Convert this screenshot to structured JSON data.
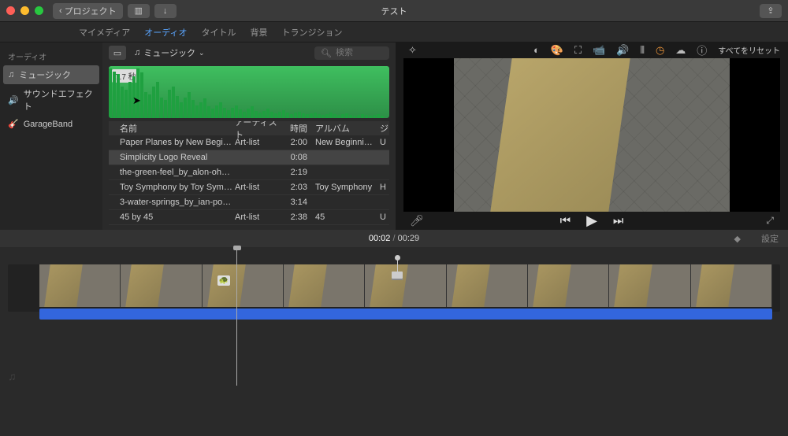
{
  "titlebar": {
    "back": "プロジェクト",
    "title": "テスト"
  },
  "tabs": [
    "マイメディア",
    "オーディオ",
    "タイトル",
    "背景",
    "トランジション"
  ],
  "tabs_active": 1,
  "sidebar": {
    "header": "オーディオ",
    "items": [
      {
        "icon": "♫",
        "label": "ミュージック",
        "sel": true
      },
      {
        "icon": "🔊",
        "label": "サウンドエフェクト"
      },
      {
        "icon": "🎸",
        "label": "GarageBand"
      }
    ]
  },
  "browser": {
    "source": "ミュージック",
    "search_ph": "検索",
    "waveform_dur": "7.7 秒",
    "headers": {
      "name": "名前",
      "artist": "アーティスト",
      "time": "時間",
      "album": "アルバム",
      "genre": "ジ"
    },
    "rows": [
      {
        "name": "Paper Planes by New Beginn...",
        "artist": "Art-list",
        "time": "2:00",
        "album": "New Beginnin...",
        "g": "U"
      },
      {
        "name": "Simplicity Logo Reveal",
        "artist": "",
        "time": "0:08",
        "album": "",
        "g": "",
        "sel": true
      },
      {
        "name": "the-green-feel_by_alon-ohan...",
        "artist": "",
        "time": "2:19",
        "album": "",
        "g": ""
      },
      {
        "name": "Toy Symphony by Toy Symp...",
        "artist": "Art-list",
        "time": "2:03",
        "album": "Toy Symphony",
        "g": "H"
      },
      {
        "name": "3-water-springs_by_ian-post...",
        "artist": "",
        "time": "3:14",
        "album": "",
        "g": ""
      },
      {
        "name": "45 by 45",
        "artist": "Art-list",
        "time": "2:38",
        "album": "45",
        "g": "U"
      }
    ]
  },
  "preview": {
    "reset": "すべてをリセット"
  },
  "time": {
    "current": "00:02",
    "total": "00:29",
    "settings": "設定"
  }
}
